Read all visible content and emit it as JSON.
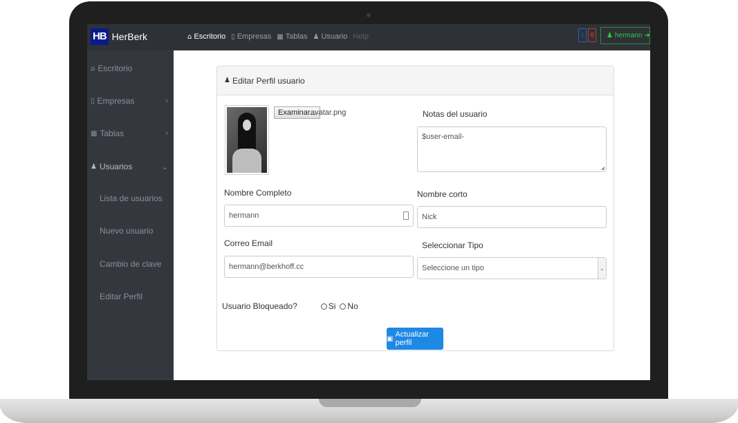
{
  "brand": {
    "logo": "HB",
    "name": "HerBerk"
  },
  "nav": {
    "items": [
      {
        "icon": "dashboard-icon",
        "label": "Escritorio"
      },
      {
        "icon": "building-icon",
        "label": "Empresas"
      },
      {
        "icon": "table-icon",
        "label": "Tablas"
      },
      {
        "icon": "user-icon",
        "label": "Usuario"
      },
      {
        "icon": "",
        "label": "Help"
      }
    ]
  },
  "social": {
    "facebook": "f",
    "map": "⚲"
  },
  "user": {
    "name": "hermann"
  },
  "sidebar": {
    "items": [
      {
        "label": "Escritorio"
      },
      {
        "label": "Empresas"
      },
      {
        "label": "Tablas"
      },
      {
        "label": "Usuarios"
      }
    ],
    "sub": [
      {
        "label": "Lista de usuarios"
      },
      {
        "label": "Nuevo usuario"
      },
      {
        "label": "Cambio de clave"
      },
      {
        "label": "Editar Perfil"
      }
    ]
  },
  "card": {
    "title": "Editar Perfil usuario"
  },
  "form": {
    "browse_label": "Examinar...",
    "filename": "avatar.png",
    "notes_label": "Notas del usuario",
    "notes_value": "$user-email-",
    "fullname_label": "Nombre Completo",
    "fullname_value": "hermann",
    "shortname_label": "Nombre corto",
    "shortname_value": "Nick",
    "email_label": "Correo Email",
    "email_value": "hermann@berkhoff.cc",
    "type_label": "Seleccionar Tipo",
    "type_value": "Seleccione un tipo",
    "blocked_label": "Usuario Bloqueado?",
    "blocked_yes": "Si",
    "blocked_no": "No",
    "submit_label": "Actualizar perfil"
  }
}
